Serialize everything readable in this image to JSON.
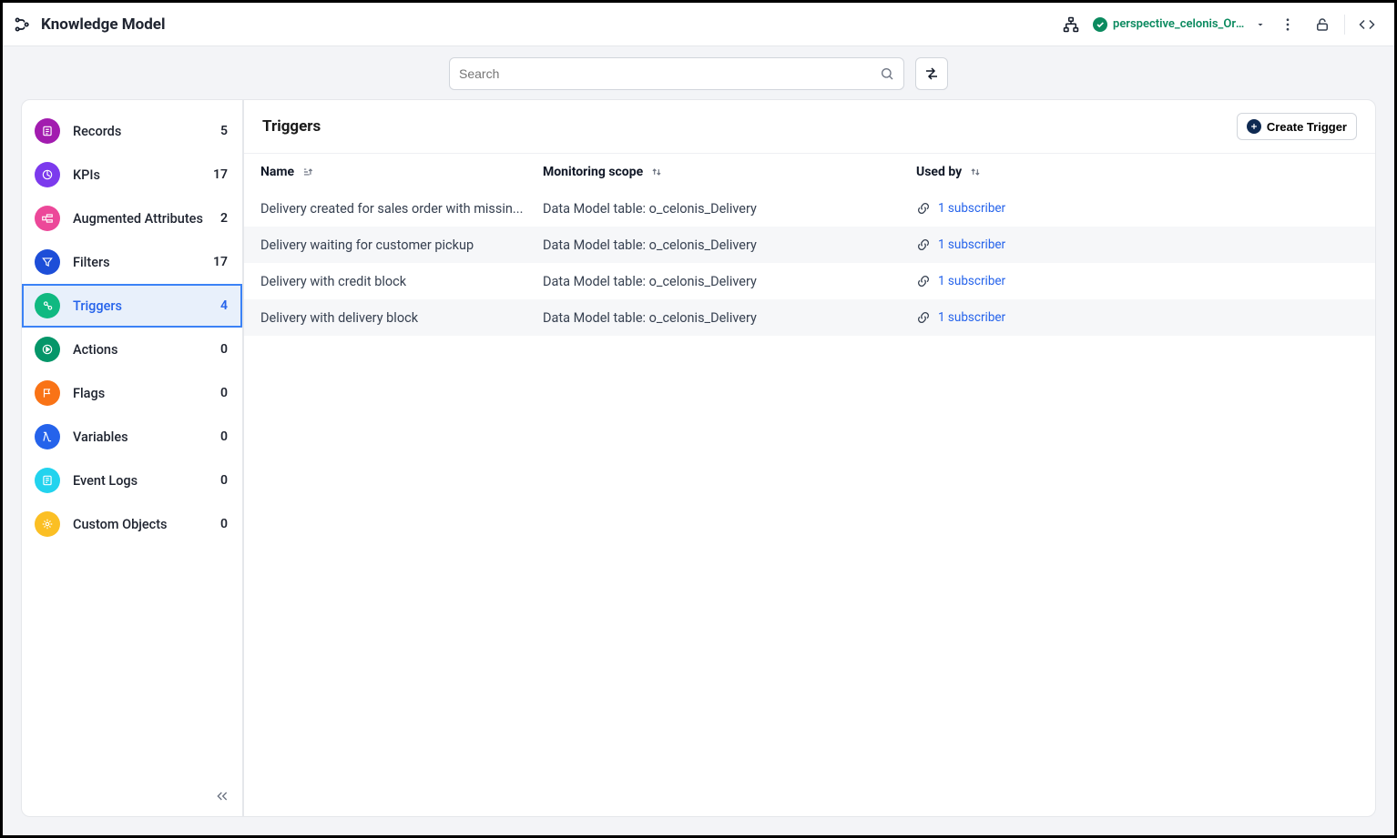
{
  "header": {
    "title": "Knowledge Model",
    "perspective_label": "perspective_celonis_Order..."
  },
  "search": {
    "placeholder": "Search"
  },
  "sidebar": {
    "items": [
      {
        "label": "Records",
        "count": "5"
      },
      {
        "label": "KPIs",
        "count": "17"
      },
      {
        "label": "Augmented Attributes",
        "count": "2"
      },
      {
        "label": "Filters",
        "count": "17"
      },
      {
        "label": "Triggers",
        "count": "4"
      },
      {
        "label": "Actions",
        "count": "0"
      },
      {
        "label": "Flags",
        "count": "0"
      },
      {
        "label": "Variables",
        "count": "0"
      },
      {
        "label": "Event Logs",
        "count": "0"
      },
      {
        "label": "Custom Objects",
        "count": "0"
      }
    ]
  },
  "main": {
    "title": "Triggers",
    "create_button": "Create Trigger",
    "columns": {
      "name": "Name",
      "scope": "Monitoring scope",
      "usedby": "Used by"
    },
    "rows": [
      {
        "name": "Delivery created for sales order with missin...",
        "scope": "Data Model table: o_celonis_Delivery",
        "usedby": "1 subscriber"
      },
      {
        "name": "Delivery waiting for customer pickup",
        "scope": "Data Model table: o_celonis_Delivery",
        "usedby": "1 subscriber"
      },
      {
        "name": "Delivery with credit block",
        "scope": "Data Model table: o_celonis_Delivery",
        "usedby": "1 subscriber"
      },
      {
        "name": "Delivery with delivery block",
        "scope": "Data Model table: o_celonis_Delivery",
        "usedby": "1 subscriber"
      }
    ]
  }
}
